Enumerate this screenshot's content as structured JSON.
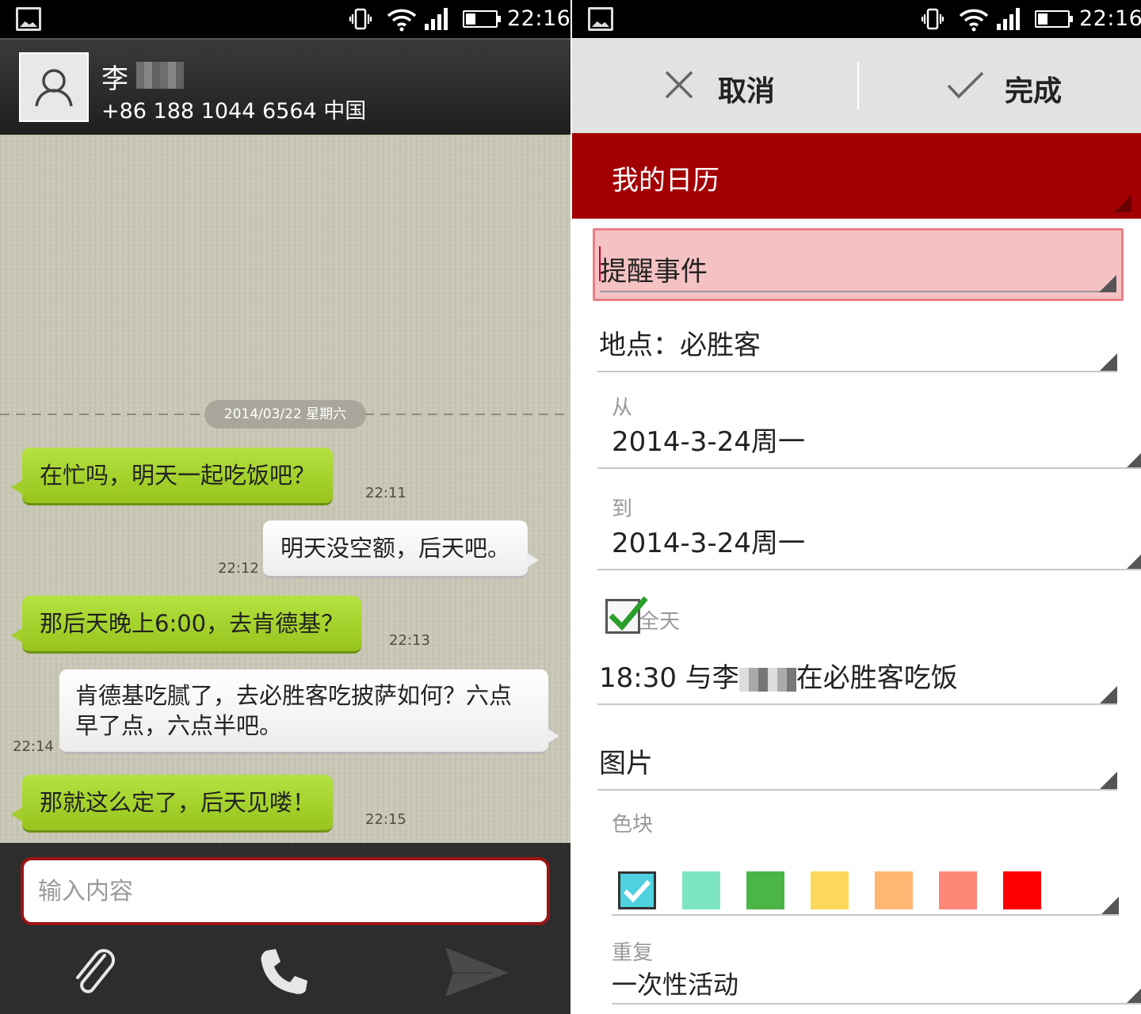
{
  "status_bar": {
    "time": "22:16"
  },
  "chat": {
    "contact": {
      "name": "李",
      "phone": "+86 188 1044 6564  中国"
    },
    "date_divider": "2014/03/22  星期六",
    "messages": [
      {
        "dir": "in",
        "text": "在忙吗，明天一起吃饭吧？",
        "time": "22:11"
      },
      {
        "dir": "out",
        "text": "明天没空额，后天吧。",
        "time": "22:12"
      },
      {
        "dir": "in",
        "text": "那后天晚上6:00，去肯德基？",
        "time": "22:13"
      },
      {
        "dir": "out",
        "text": "肯德基吃腻了，去必胜客吃披萨如何？六点早了点，六点半吧。",
        "time": "22:14"
      },
      {
        "dir": "in",
        "text": "那就这么定了，后天见喽！",
        "time": "22:15"
      }
    ],
    "input": {
      "placeholder": "输入内容",
      "value": ""
    },
    "toolbar": {
      "icons": [
        "paperclip-icon",
        "phone-icon",
        "send-icon"
      ]
    }
  },
  "calendar": {
    "actions": {
      "cancel": "取消",
      "done": "完成"
    },
    "calendar_name": "我的日历",
    "title_value": "提醒事件",
    "location_value": "地点：必胜客",
    "from_caption": "从",
    "from_value": "2014-3-24周一",
    "to_caption": "到",
    "to_value": "2014-3-24周一",
    "all_day": {
      "label": "全天",
      "checked": true
    },
    "description_prefix": "18:30 与李",
    "description_suffix": "在必胜客吃饭",
    "image_label": "图片",
    "color_caption": "色块",
    "colors": [
      "#4fd1e0",
      "#7de6c0",
      "#4bb548",
      "#fcd85a",
      "#ffb774",
      "#ff8778",
      "#ff0000"
    ],
    "selected_color": "#4fd1e0",
    "repeat_caption": "重复",
    "repeat_value": "一次性活动"
  }
}
